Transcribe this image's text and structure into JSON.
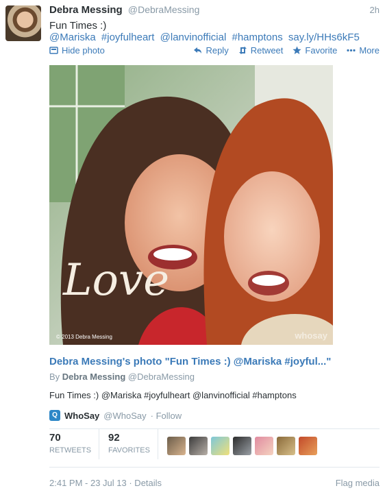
{
  "tweet": {
    "name": "Debra Messing",
    "handle": "@DebraMessing",
    "time": "2h",
    "text": "Fun Times :)",
    "links": [
      "@Mariska",
      "#joyfulheart",
      "@lanvinofficial",
      "#hamptons",
      "say.ly/HHs6kF5"
    ]
  },
  "actions": {
    "hide_photo": "Hide photo",
    "reply": "Reply",
    "retweet": "Retweet",
    "favorite": "Favorite",
    "more": "More"
  },
  "photo": {
    "script_text": "Love",
    "copyright": "© 2013 Debra Messing",
    "watermark": "whosay"
  },
  "card": {
    "title": "Debra Messing's photo \"Fun Times :) @Mariska #joyful...\"",
    "by_prefix": "By",
    "by_name": "Debra Messing",
    "by_handle": "@DebraMessing",
    "description": "Fun Times :) @Mariska #joyfulheart @lanvinofficial #hamptons"
  },
  "source": {
    "name": "WhoSay",
    "handle": "@WhoSay",
    "follow": "· Follow"
  },
  "stats": {
    "retweets_count": "70",
    "retweets_label": "RETWEETS",
    "favorites_count": "92",
    "favorites_label": "FAVORITES"
  },
  "footer": {
    "timestamp": "2:41 PM - 23 Jul 13",
    "details": "· Details",
    "flag": "Flag media"
  },
  "colors": {
    "link": "#3b7ab8",
    "muted": "#8899a6"
  }
}
